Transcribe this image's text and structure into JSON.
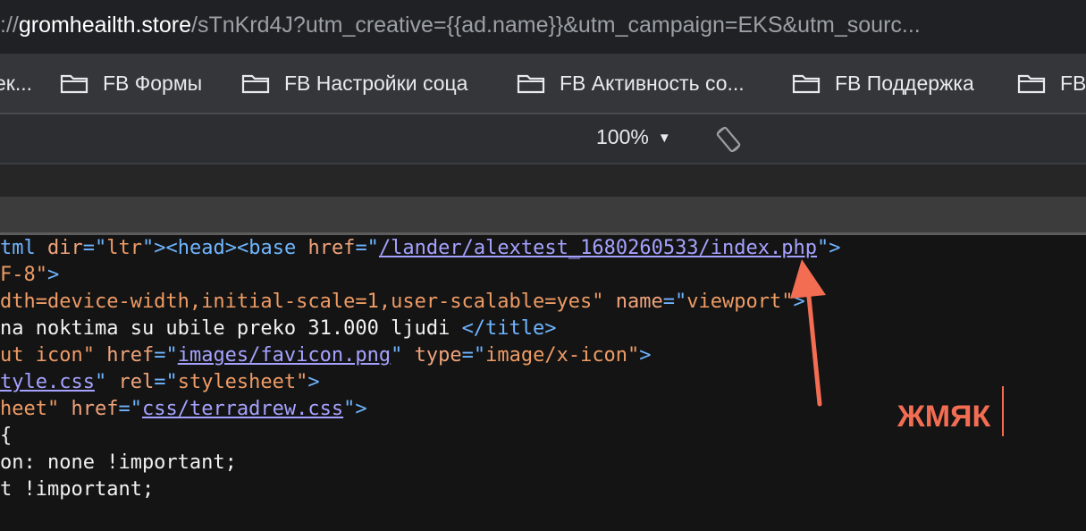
{
  "address_bar": {
    "scheme": "://",
    "host": "gromheailth.store",
    "path": "/sTnKrd4J?utm_creative={{ad.name}}&utm_campaign=EKS&utm_sourc..."
  },
  "bookmarks": [
    {
      "label": "ек..."
    },
    {
      "label": "FB Формы"
    },
    {
      "label": "FB Настройки соца"
    },
    {
      "label": "FB Активность со..."
    },
    {
      "label": "FB Поддержка"
    },
    {
      "label": "FB"
    }
  ],
  "toolbar": {
    "zoom": "100%",
    "zoom_caret": "▼",
    "rotate_icon": "rotate-icon"
  },
  "source": {
    "l1": {
      "a": "tml",
      "b": " dir",
      "c": "=\"",
      "d": "ltr",
      "e": "\"><",
      "f": "head",
      "g": "><",
      "h": "base",
      "i": " href",
      "j": "=\"",
      "k": "/lander/alextest_1680260533/index.php",
      "l": "\">"
    },
    "l2": {
      "a": "F-8\"",
      "b": ">"
    },
    "l3": {
      "a": "dth=device-width,initial-scale=1,user-scalable=yes\"",
      "b": " name",
      "c": "=\"",
      "d": "viewport\"",
      "e": ">"
    },
    "l4": {
      "a": "na noktima su ubile preko 31.000 ljudi ",
      "b": "</title>"
    },
    "l5": {
      "a": "ut icon\"",
      "b": " href",
      "c": "=\"",
      "d": "images/favicon.png",
      "e": "\"",
      "f": " type",
      "g": "=\"",
      "h": "image/x-icon\"",
      "i": ">"
    },
    "l6": {
      "a": "tyle.css",
      "b": "\"",
      "c": " rel",
      "d": "=\"",
      "e": "stylesheet\"",
      "f": ">"
    },
    "l7": {
      "a": "heet\"",
      "b": " href",
      "c": "=\"",
      "d": "css/terradrew.css",
      "e": "\">"
    },
    "l8": {
      "a": "{"
    },
    "l9": {
      "a": "on: none !important;"
    },
    "l10": {
      "a": "t !important;"
    }
  },
  "annotation": {
    "text": "ЖМЯК",
    "color": "#f26d52"
  }
}
